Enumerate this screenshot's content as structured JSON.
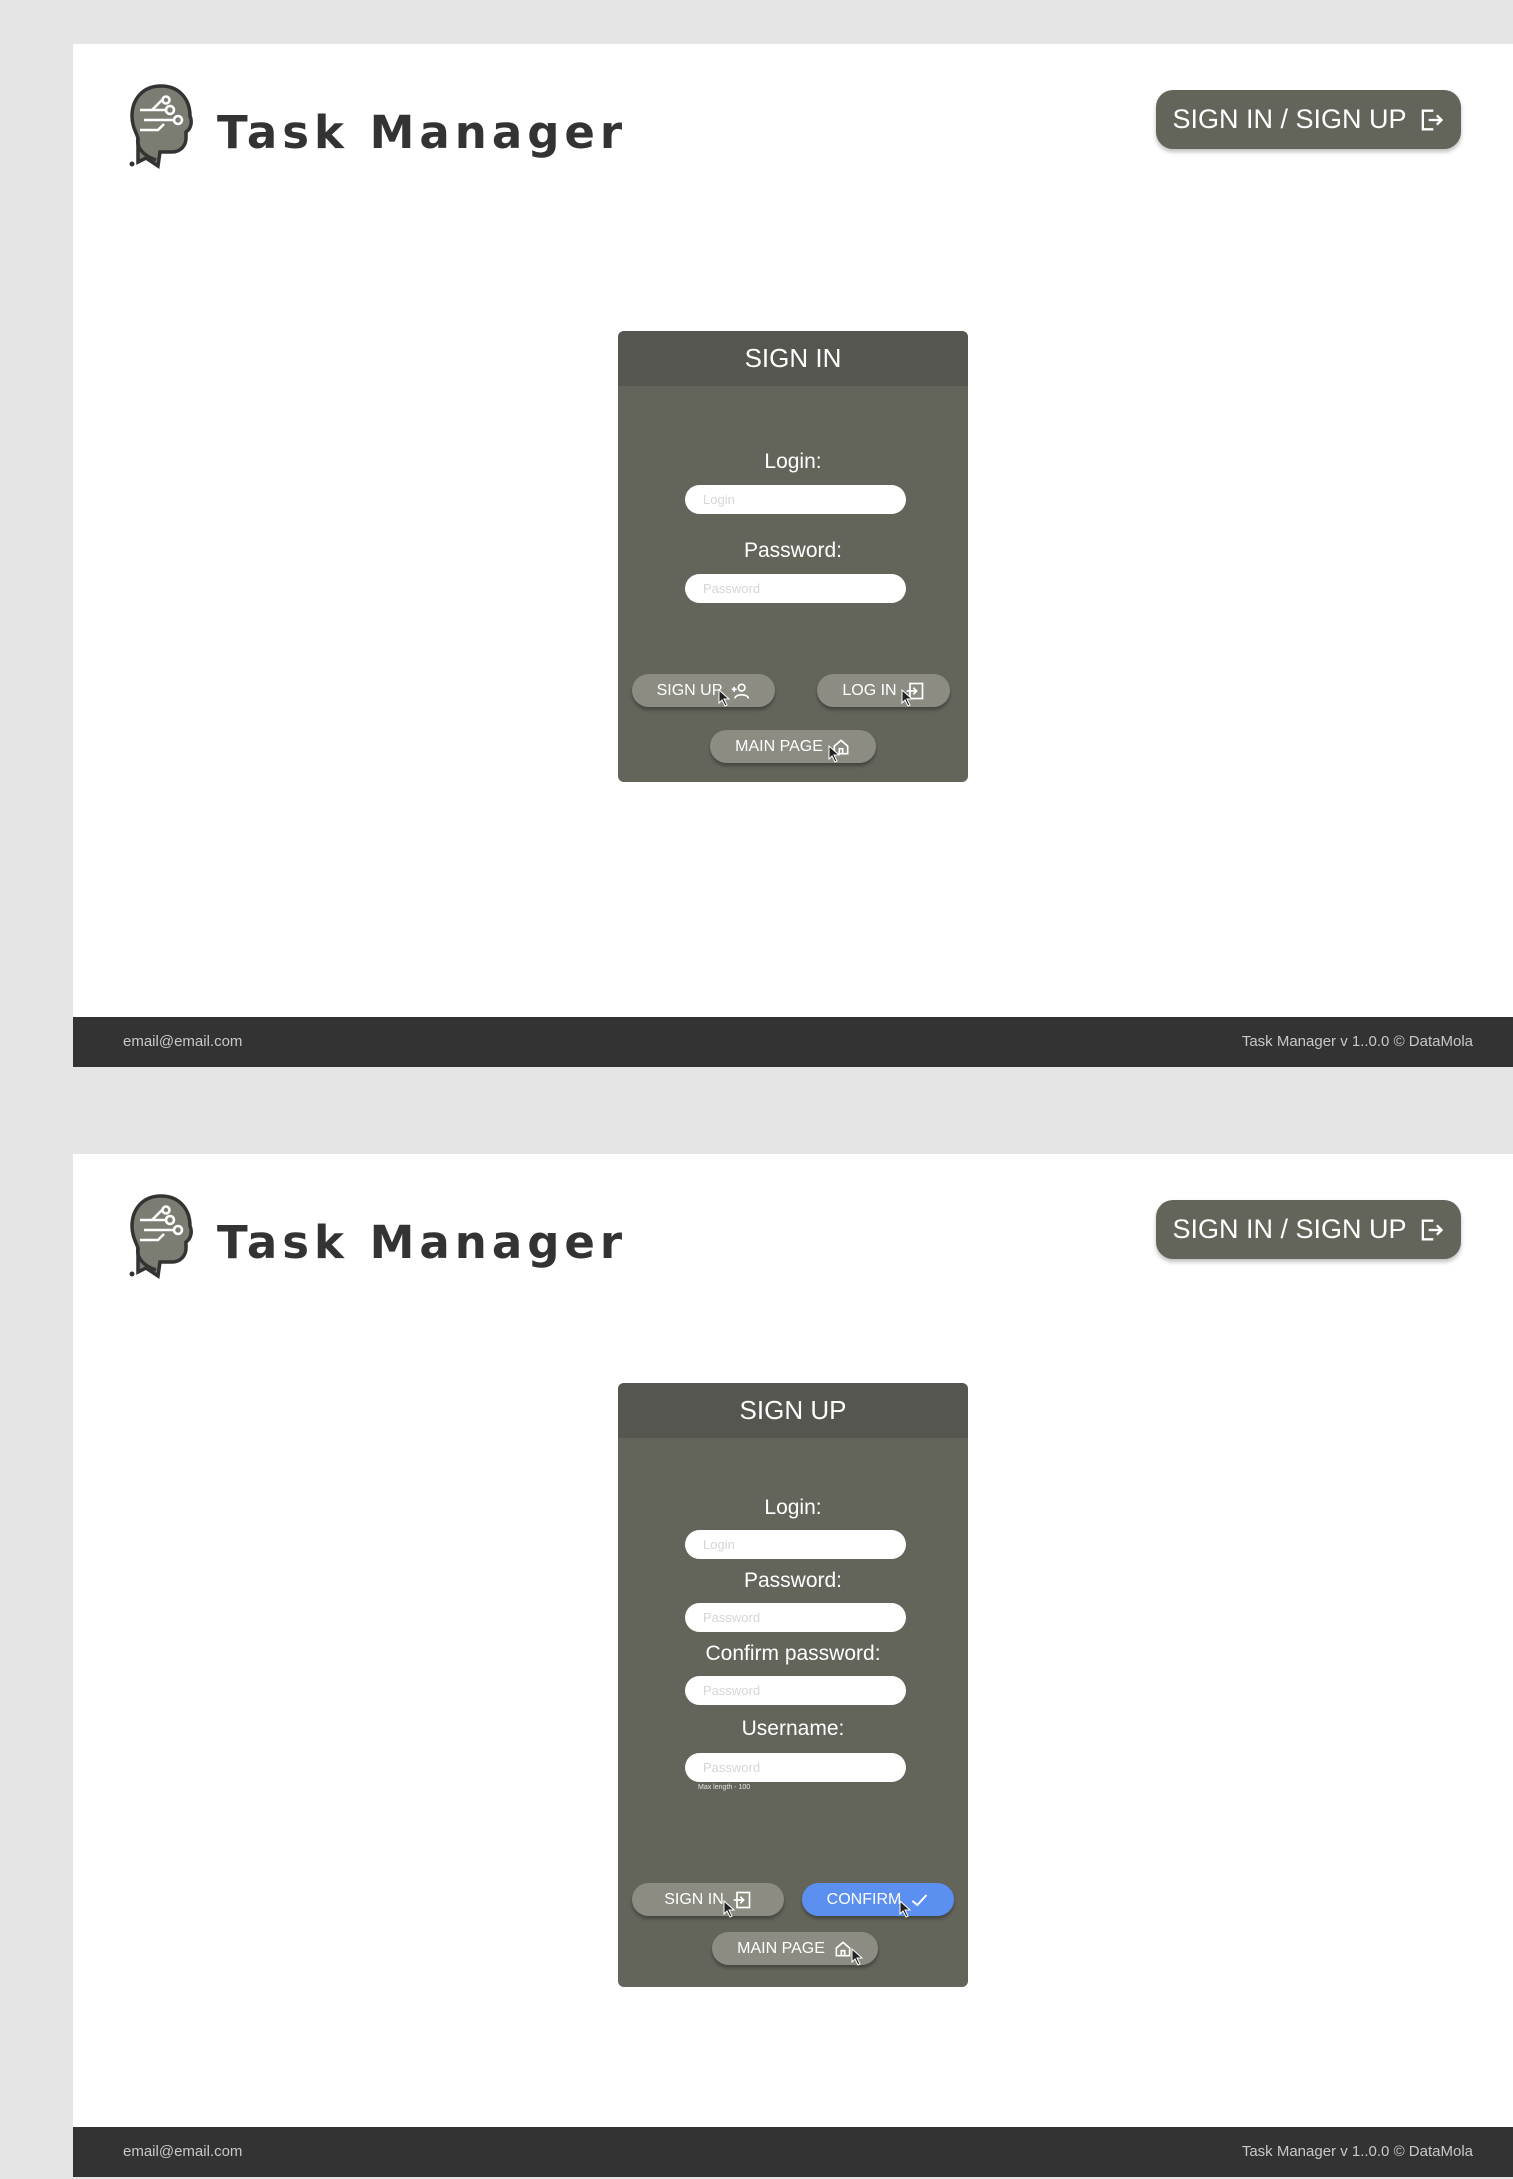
{
  "app": {
    "title": "Task Manager",
    "header_button": "SIGN IN / SIGN UP"
  },
  "colors": {
    "card": "#63655b",
    "card_header": "#55564f",
    "pill": "#8c8c83",
    "confirm": "#5b8ff0",
    "footer": "#333333"
  },
  "signin": {
    "title": "SIGN IN",
    "login_label": "Login:",
    "login_placeholder": "Login",
    "password_label": "Password:",
    "password_placeholder": "Password",
    "signup_button": "SIGN UP",
    "login_button": "LOG IN",
    "main_button": "MAIN PAGE"
  },
  "signup": {
    "title": "SIGN UP",
    "login_label": "Login:",
    "login_placeholder": "Login",
    "password_label": "Password:",
    "password_placeholder": "Password",
    "confirm_label": "Confirm password:",
    "confirm_placeholder": "Password",
    "username_label": "Username:",
    "username_placeholder": "Password",
    "username_hint": "Max length - 100",
    "signin_button": "SIGN IN",
    "confirm_button": "CONFIRM",
    "main_button": "MAIN PAGE"
  },
  "footer": {
    "email": "email@email.com",
    "copyright": "Task Manager v 1..0.0  © DataMola"
  },
  "icons": [
    "logo-head-circuit",
    "logout-arrow-icon",
    "user-add-icon",
    "login-arrow-icon",
    "home-icon",
    "check-icon",
    "cursor-icon"
  ]
}
